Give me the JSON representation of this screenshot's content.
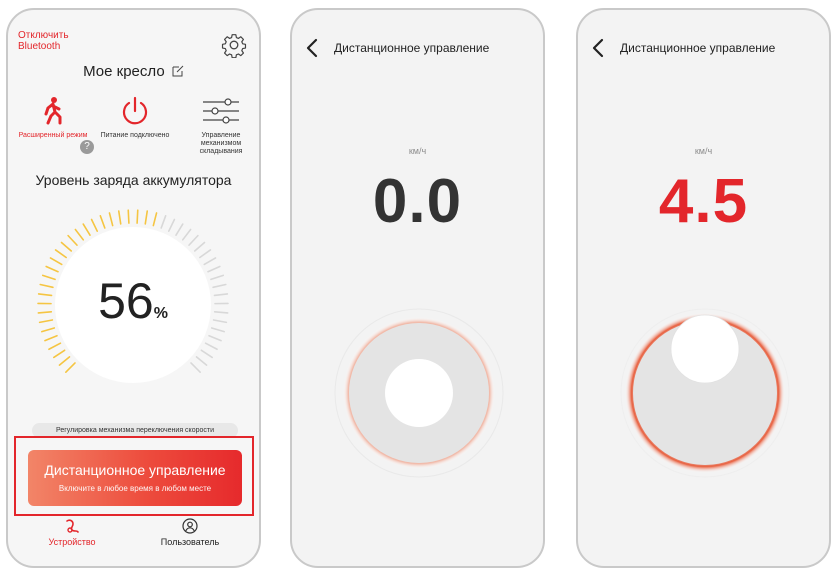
{
  "screen1": {
    "bluetooth_label": "Отключить\nBluetooth",
    "chair_title": "Мое кресло",
    "modes": [
      {
        "label": "Расширенный режим",
        "icon": "walking-person-icon",
        "color": "#e3262b"
      },
      {
        "label": "Питание подключено",
        "icon": "power-icon",
        "color": "#e3262b"
      },
      {
        "label": "Управление механизмом складывания",
        "icon": "sliders-icon",
        "color": "#333333"
      }
    ],
    "help_label": "?",
    "battery_title": "Уровень заряда аккумулятора",
    "battery_value": "56",
    "battery_unit": "%",
    "battery_level": 0.56,
    "speed_switch_label": "Регулировка механизма переключения скорости",
    "remote_button": {
      "title": "Дистанционное управление",
      "subtitle": "Включите в любое время в любом месте"
    },
    "nav": [
      {
        "label": "Устройство",
        "active": true
      },
      {
        "label": "Пользователь",
        "active": false
      }
    ]
  },
  "screen2": {
    "title": "Дистанционное управление",
    "unit": "км/ч",
    "speed": "0.0",
    "knob": "center"
  },
  "screen3": {
    "title": "Дистанционное управление",
    "unit": "км/ч",
    "speed": "4.5",
    "knob": "top"
  },
  "colors": {
    "accent": "#e3262b",
    "gauge_on": "#f5c542",
    "gauge_off": "#d8d8d8"
  }
}
